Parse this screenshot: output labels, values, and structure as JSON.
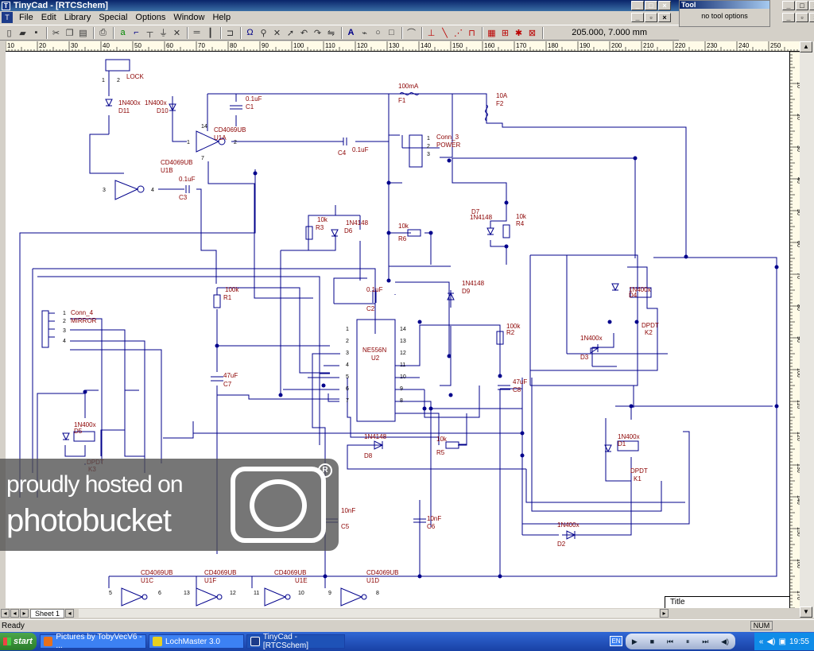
{
  "window": {
    "title": "TinyCad - [RTCSchem]",
    "app_icon": "T"
  },
  "menu": [
    "File",
    "Edit",
    "Library",
    "Special",
    "Options",
    "Window",
    "Help"
  ],
  "tool_panel": {
    "title": "Tool",
    "text": "no tool options"
  },
  "toolbar": {
    "coords": "205.000,    7.000 mm",
    "icons": [
      "new-icon",
      "open-icon",
      "save-icon",
      "cut-icon",
      "copy-icon",
      "paste-icon",
      "print-icon",
      "wire-icon",
      "bus-icon",
      "power-icon",
      "ground-icon",
      "no-connect-icon",
      "label-icon",
      "junction-icon",
      "symbol-icon",
      "zoom-icon",
      "delete-icon",
      "select-icon",
      "rotate-icon",
      "mirror-icon",
      "flip-icon",
      "text-icon",
      "polygon-icon",
      "circle-icon",
      "rect-icon",
      "arc-icon"
    ]
  },
  "ruler": {
    "top_ticks": [
      "10",
      "20",
      "30",
      "40",
      "50",
      "60",
      "70",
      "80",
      "90",
      "100",
      "110",
      "120",
      "130",
      "140",
      "150",
      "160",
      "170",
      "180",
      "190",
      "200",
      "210",
      "220",
      "230",
      "240",
      "250"
    ],
    "right_ticks": [
      "10",
      "20",
      "30",
      "40",
      "50",
      "60",
      "70",
      "80",
      "90",
      "100",
      "110",
      "120",
      "130",
      "140",
      "150",
      "160",
      "170"
    ]
  },
  "schematic": {
    "labels": {
      "lock": "LOCK",
      "d11": "1N400x",
      "d11ref": "D11",
      "d10": "1N400x",
      "d10ref": "D10",
      "u1a_name": "CD4069UB",
      "u1a_ref": "U1A",
      "u1b_name": "CD4069UB",
      "u1b_ref": "U1B",
      "c1v": "0.1uF",
      "c1": "C1",
      "c3v": "0.1uF",
      "c3": "C3",
      "c4v": "0.1uF",
      "c4": "C4",
      "f1v": "100mA",
      "f1": "F1",
      "f2v": "10A",
      "f2": "F2",
      "conn3": "Conn_3",
      "power": "POWER",
      "r3v": "10k",
      "r3": "R3",
      "d6v": "1N4148",
      "d6": "D6",
      "r6v": "10k",
      "r6": "R6",
      "d7": "D7",
      "d7v": "1N4148",
      "r4v": "10k",
      "r4": "R4",
      "r1v": "100k",
      "r1": "R1",
      "c2v": "0.1uF",
      "c2": "C2",
      "d9v": "1N4148",
      "d9": "D9",
      "conn4": "Conn_4",
      "mirror": "MIRROR",
      "ne": "NE556N",
      "u2": "U2",
      "r2v": "100k",
      "r2": "R2",
      "c7v": "47uF",
      "c7": "C7",
      "c8v": "47uF",
      "c8": "C8",
      "k2d": "1N400x",
      "k2dref": "D4",
      "dpdt": "DPDT",
      "k2": "K2",
      "d3v": "1N400x",
      "d3": "D3",
      "k3d": "1N400x",
      "k3dref": "D5",
      "k3": "K3",
      "d8v": "1N4148",
      "d8": "D8",
      "r5v": "10k",
      "r5": "R5",
      "k1d": "1N400x",
      "k1dref": "D1",
      "k1": "K1",
      "c5v": "10nF",
      "c5": "C5",
      "c6v": "10nF",
      "c6": "C6",
      "d2v": "1N400x",
      "d2": "D2",
      "u1c_name": "CD4069UB",
      "u1c": "U1C",
      "u1f_name": "CD4069UB",
      "u1f": "U1F",
      "u1e_name": "CD4069UB",
      "u1e": "U1E",
      "u1d_name": "CD4069UB",
      "u1d": "U1D",
      "title": "Title"
    }
  },
  "sheet_tab": "Sheet 1",
  "status": {
    "text": "Ready",
    "num": "NUM"
  },
  "taskbar": {
    "start": "start",
    "tasks": [
      {
        "label": "Pictures by TobyVecV6 - ..."
      },
      {
        "label": "LochMaster 3.0"
      },
      {
        "label": "TinyCad - [RTCSchem]"
      }
    ],
    "lang": "EN",
    "clock": "19:55"
  },
  "watermark": {
    "line1": "proudly hosted on",
    "line2": "photobucket",
    "reg": "R"
  },
  "colors": {
    "wire": "#00008b",
    "part": "#8b0000",
    "titlebar": "#0a246a",
    "taskbar": "#3168d5"
  }
}
